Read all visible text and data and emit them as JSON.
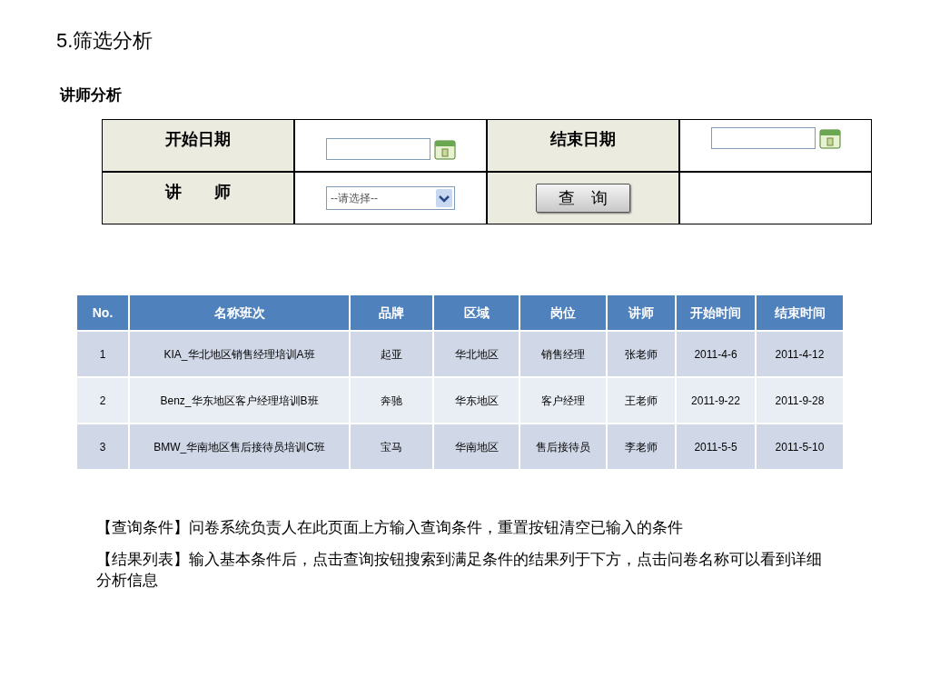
{
  "title": "5.筛选分析",
  "subtitle": "讲师分析",
  "filter": {
    "start_label": "开始日期",
    "end_label": "结束日期",
    "teacher_label": "讲　　师",
    "teacher_select": {
      "value": "--请选择--"
    },
    "query_button": "查　询"
  },
  "table": {
    "columns": [
      "No.",
      "名称班次",
      "品牌",
      "区域",
      "岗位",
      "讲师",
      "开始时间",
      "结束时间"
    ],
    "rows": [
      [
        "1",
        "KIA_华北地区销售经理培训A班",
        "起亚",
        "华北地区",
        "销售经理",
        "张老师",
        "2011-4-6",
        "2011-4-12"
      ],
      [
        "2",
        "Benz_华东地区客户经理培训B班",
        "奔驰",
        "华东地区",
        "客户经理",
        "王老师",
        "2011-9-22",
        "2011-9-28"
      ],
      [
        "3",
        "BMW_华南地区售后接待员培训C班",
        "宝马",
        "华南地区",
        "售后接待员",
        "李老师",
        "2011-5-5",
        "2011-5-10"
      ]
    ]
  },
  "notes": [
    "【查询条件】问卷系统负责人在此页面上方输入查询条件，重置按钮清空已输入的条件",
    "【结果列表】输入基本条件后，点击查询按钮搜索到满足条件的结果列于下方，点击问卷名称可以看到详细分析信息"
  ]
}
